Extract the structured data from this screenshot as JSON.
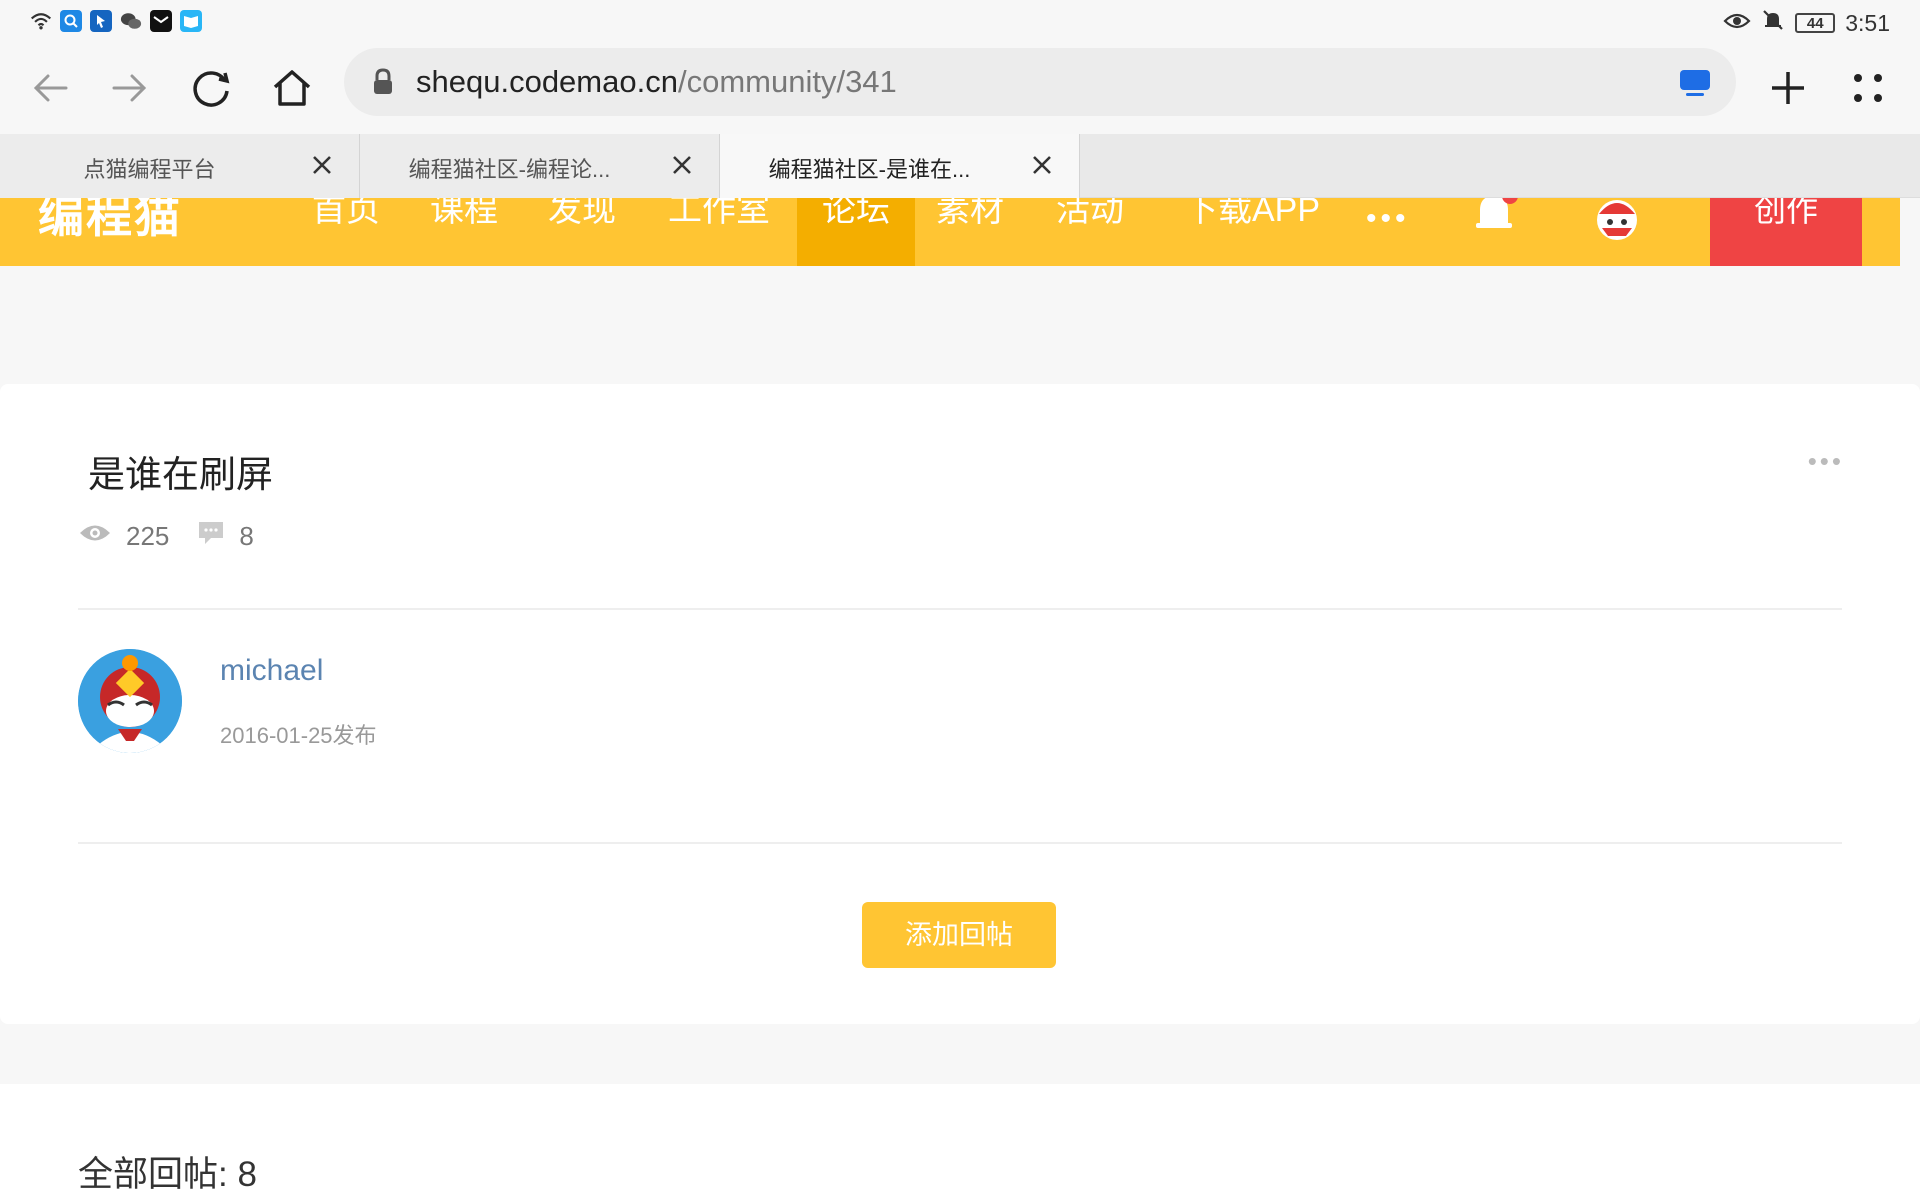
{
  "status_bar": {
    "time": "3:51",
    "battery": "44",
    "icons": [
      "wifi-icon",
      "search-app-icon",
      "pin-app-icon",
      "wechat-icon",
      "mail-app-icon",
      "reader-app-icon"
    ],
    "right_icons": [
      "eye-icon",
      "bell-muted-icon",
      "battery-icon"
    ]
  },
  "browser": {
    "url_domain": "shequ.codemao.cn",
    "url_path": "/community/341",
    "buttons": [
      "back-icon",
      "forward-icon",
      "reload-icon",
      "home-icon",
      "new-tab-icon",
      "menu-icon"
    ]
  },
  "tabs": [
    {
      "title": "点猫编程平台",
      "active": false
    },
    {
      "title": "编程猫社区-编程论...",
      "active": false
    },
    {
      "title": "编程猫社区-是谁在...",
      "active": true
    }
  ],
  "site_nav": {
    "logo": "编程猫",
    "items": [
      "首页",
      "课程",
      "发现",
      "工作室",
      "论坛",
      "素材",
      "活动",
      "下载APP"
    ],
    "active_index": 4,
    "more": "•••",
    "create_label": "创作"
  },
  "post": {
    "title": "是谁在刷屏",
    "more": "•••",
    "views": "225",
    "comments": "8",
    "author": "michael",
    "date": "2016-01-25发布",
    "reply_button": "添加回帖"
  },
  "replies": {
    "header": "全部回帖: 8"
  },
  "colors": {
    "nav_bg": "#ffc533",
    "nav_active": "#f4ae00",
    "create_bg": "#ef4444",
    "author_link": "#5b84b1"
  }
}
